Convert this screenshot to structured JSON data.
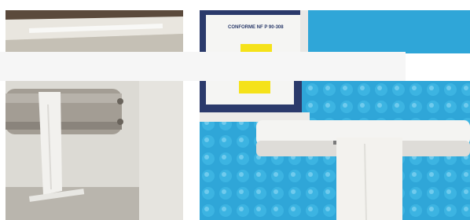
{
  "label_text": "CONFORME NF P 90-308",
  "colors": {
    "pool_water": "#2fa6d8",
    "rail": "#f4f4f2",
    "wall_beige": "#cfc9bd",
    "roller_grey": "#a09a92",
    "sticker_yellow": "#f5e21a"
  }
}
